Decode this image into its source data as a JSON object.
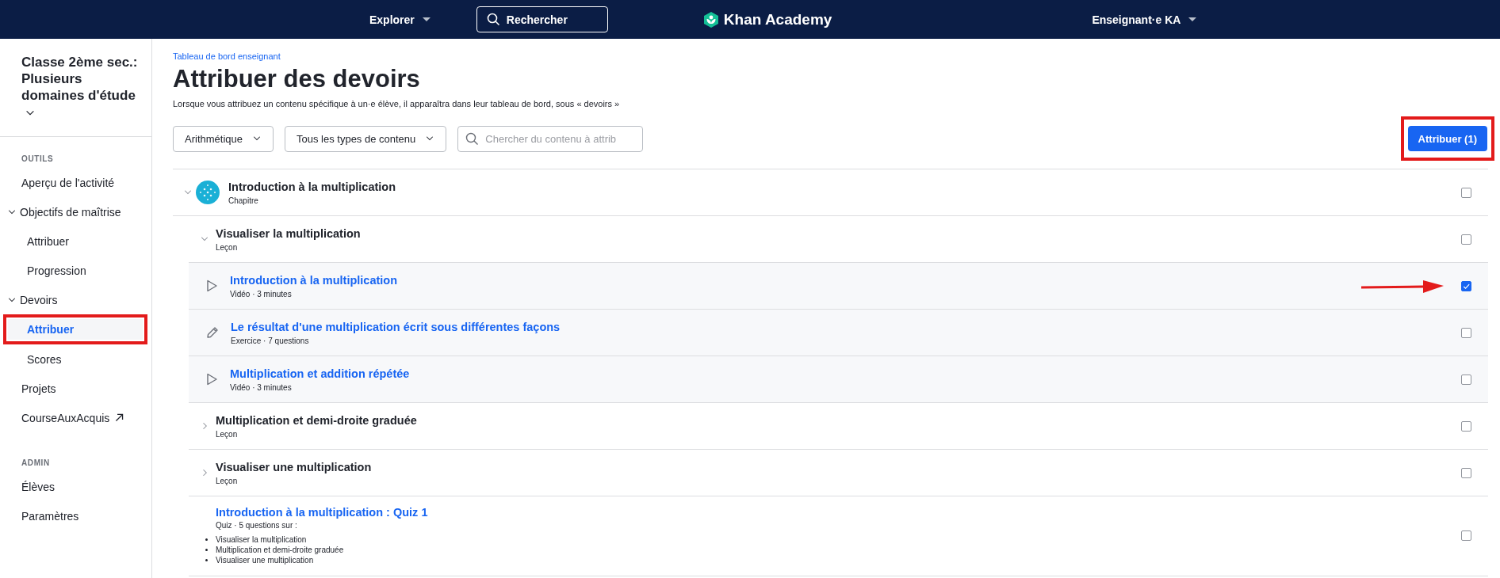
{
  "topbar": {
    "explore": "Explorer",
    "search": "Rechercher",
    "logo": "Khan Academy",
    "user": "Enseignant·e KA"
  },
  "sidebar": {
    "class_name": "Classe 2ème sec.: Plusieurs domaines d'étude",
    "sections": [
      {
        "heading": "OUTILS",
        "items": [
          {
            "kind": "link",
            "label": "Aperçu de l'activité",
            "selected": false,
            "framed": false
          },
          {
            "kind": "group",
            "label": "Objectifs de maîtrise",
            "expanded": true,
            "children": [
              {
                "kind": "link",
                "label": "Attribuer",
                "selected": false,
                "framed": false
              },
              {
                "kind": "link",
                "label": "Progression",
                "selected": false,
                "framed": false
              }
            ]
          },
          {
            "kind": "group",
            "label": "Devoirs",
            "expanded": true,
            "children": [
              {
                "kind": "link",
                "label": "Attribuer",
                "selected": true,
                "framed": true
              },
              {
                "kind": "link",
                "label": "Scores",
                "selected": false,
                "framed": false
              }
            ]
          },
          {
            "kind": "link",
            "label": "Projets",
            "selected": false,
            "framed": false
          },
          {
            "kind": "external",
            "label": "CourseAuxAcquis",
            "selected": false,
            "framed": false
          }
        ]
      },
      {
        "heading": "ADMIN",
        "items": [
          {
            "kind": "link",
            "label": "Élèves",
            "selected": false,
            "framed": false
          },
          {
            "kind": "link",
            "label": "Paramètres",
            "selected": false,
            "framed": false
          }
        ]
      }
    ]
  },
  "breadcrumb": "Tableau de bord enseignant",
  "title": "Attribuer des devoirs",
  "description": "Lorsque vous attribuez un contenu spécifique à un·e élève, il apparaîtra dans leur tableau de bord, sous « devoirs »",
  "filters": {
    "subject": "Arithmétique",
    "content_type": "Tous les types de contenu",
    "search": {
      "placeholder": "Chercher du contenu à attrib"
    }
  },
  "assign_button": {
    "label": "Attribuer (1)",
    "framed": true
  },
  "rows": [
    {
      "kind": "chapter",
      "title": "Introduction à la multiplication",
      "subtitle": "Chapitre",
      "expanded": true,
      "checked": false,
      "arrow": false,
      "children": [
        {
          "kind": "lesson",
          "title": "Visualiser la multiplication",
          "subtitle": "Leçon",
          "expanded": true,
          "checked": false,
          "arrow": false,
          "children": [
            {
              "kind": "video",
              "title": "Introduction à la multiplication",
              "subtitle": "Vidéo · 3 minutes",
              "checked": true,
              "arrow": true
            },
            {
              "kind": "exercise",
              "title": "Le résultat d'une multiplication écrit sous différentes façons",
              "subtitle": "Exercice · 7 questions",
              "checked": false,
              "arrow": false
            },
            {
              "kind": "video",
              "title": "Multiplication et addition répétée",
              "subtitle": "Vidéo · 3 minutes",
              "checked": false,
              "arrow": false
            }
          ]
        },
        {
          "kind": "lesson",
          "title": "Multiplication et demi-droite graduée",
          "subtitle": "Leçon",
          "expanded": false,
          "checked": false,
          "arrow": false
        },
        {
          "kind": "lesson",
          "title": "Visualiser une multiplication",
          "subtitle": "Leçon",
          "expanded": false,
          "checked": false,
          "arrow": false
        },
        {
          "kind": "quiz",
          "title": "Introduction à la multiplication : Quiz 1",
          "subtitle": "Quiz · 5 questions sur :",
          "topics": [
            "Visualiser la multiplication",
            "Multiplication et demi-droite graduée",
            "Visualiser une multiplication"
          ],
          "checked": false,
          "arrow": false
        }
      ]
    }
  ]
}
